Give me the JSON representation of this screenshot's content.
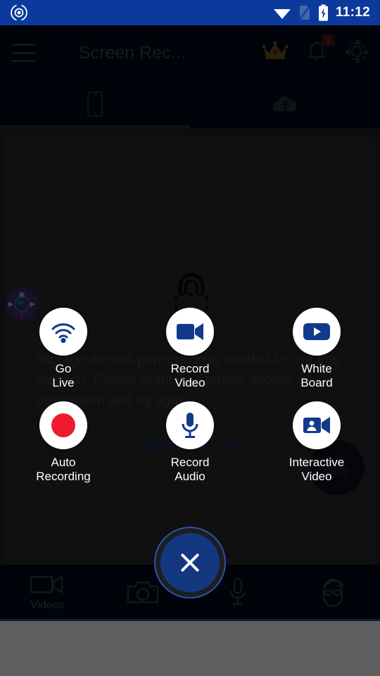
{
  "status_bar": {
    "time": "11:12",
    "icons": [
      "app-circle-icon",
      "wifi-icon",
      "sim-card-icon",
      "battery-charging-icon"
    ],
    "background_color": "#0b3a9c"
  },
  "app_bar": {
    "menu_icon": "hamburger-menu-icon",
    "title": "Screen Rec...",
    "crown_icon": "crown-icon",
    "notifications_icon": "bell-icon",
    "notifications_badge": "3",
    "settings_icon": "gear-icon"
  },
  "tabs": [
    {
      "icon": "phone-device-icon",
      "selected": true
    },
    {
      "icon": "cloud-upload-icon",
      "selected": false
    }
  ],
  "content": {
    "lock_icon": "lock-icon",
    "permission_message": "Storage access permission is needed to use this function.\nPlease grant us Storage access permission and try again.",
    "turn_on_label": "Turn it on >>",
    "fab_icon": "add-video-icon"
  },
  "floating_widget": {
    "name": "floating-recorder-widget",
    "center_icon": "camera-lens-icon",
    "mini_icons": [
      "camera-icon",
      "video-left-icon",
      "video-right-icon",
      "download-icon"
    ]
  },
  "action_menu": {
    "rows": [
      [
        {
          "label": "Go\nLive",
          "icon": "wifi-broadcast-icon",
          "icon_color": "#123a8c"
        },
        {
          "label": "Record\nVideo",
          "icon": "video-camera-icon",
          "icon_color": "#123a8c"
        },
        {
          "label": "White\nBoard",
          "icon": "play-button-icon",
          "icon_color": "#123a8c"
        }
      ],
      [
        {
          "label": "Auto\nRecording",
          "icon": "record-dot-icon",
          "icon_color": "#ee1b2e"
        },
        {
          "label": "Record\nAudio",
          "icon": "microphone-icon",
          "icon_color": "#123a8c"
        },
        {
          "label": "Interactive\nVideo",
          "icon": "interactive-video-icon",
          "icon_color": "#123a8c"
        }
      ]
    ],
    "close_label": "close-menu"
  },
  "bottom_nav": [
    {
      "icon": "video-camera-icon",
      "label": "Videos"
    },
    {
      "icon": "photo-camera-icon",
      "label": ""
    },
    {
      "icon": "microphone-icon",
      "label": ""
    },
    {
      "icon": "face-avatar-icon",
      "label": ""
    }
  ],
  "colors": {
    "accent_blue": "#14387f",
    "status_blue": "#0b3a9c",
    "record_red": "#ee1b2e",
    "app_dark": "#030a1c",
    "content_dark": "#232427"
  }
}
